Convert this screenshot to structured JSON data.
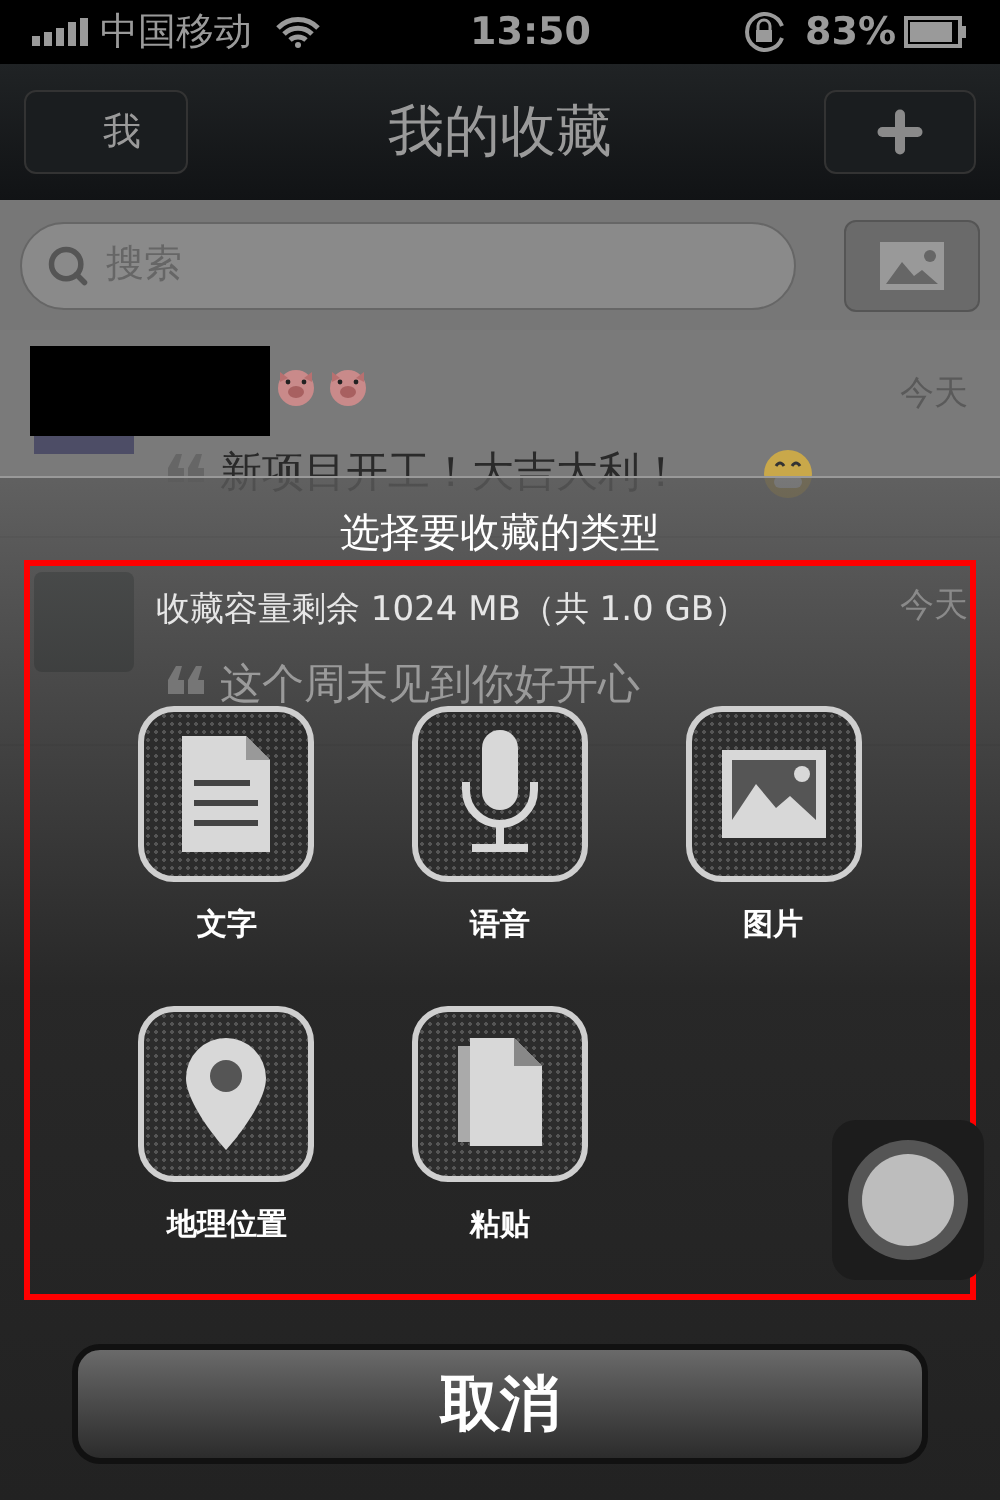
{
  "status_bar": {
    "carrier": "中国移动",
    "time": "13:50",
    "battery": "83%"
  },
  "nav_bar": {
    "back": "我",
    "title": "我的收藏"
  },
  "search": {
    "placeholder": "搜索"
  },
  "favorites": [
    {
      "kind": "redacted",
      "date": "今天",
      "text": "新项目开工！大吉大利！"
    },
    {
      "kind": "photo",
      "date": "今天",
      "text": "这个周末见到你好开心"
    }
  ],
  "sheet": {
    "title": "选择要收藏的类型",
    "capacity": "收藏容量剩余 1024 MB（共 1.0 GB）",
    "options": [
      {
        "kind": "text",
        "label": "文字"
      },
      {
        "kind": "voice",
        "label": "语音"
      },
      {
        "kind": "image",
        "label": "图片"
      },
      {
        "kind": "location",
        "label": "地理位置"
      },
      {
        "kind": "paste",
        "label": "粘贴"
      }
    ],
    "cancel": "取消"
  }
}
